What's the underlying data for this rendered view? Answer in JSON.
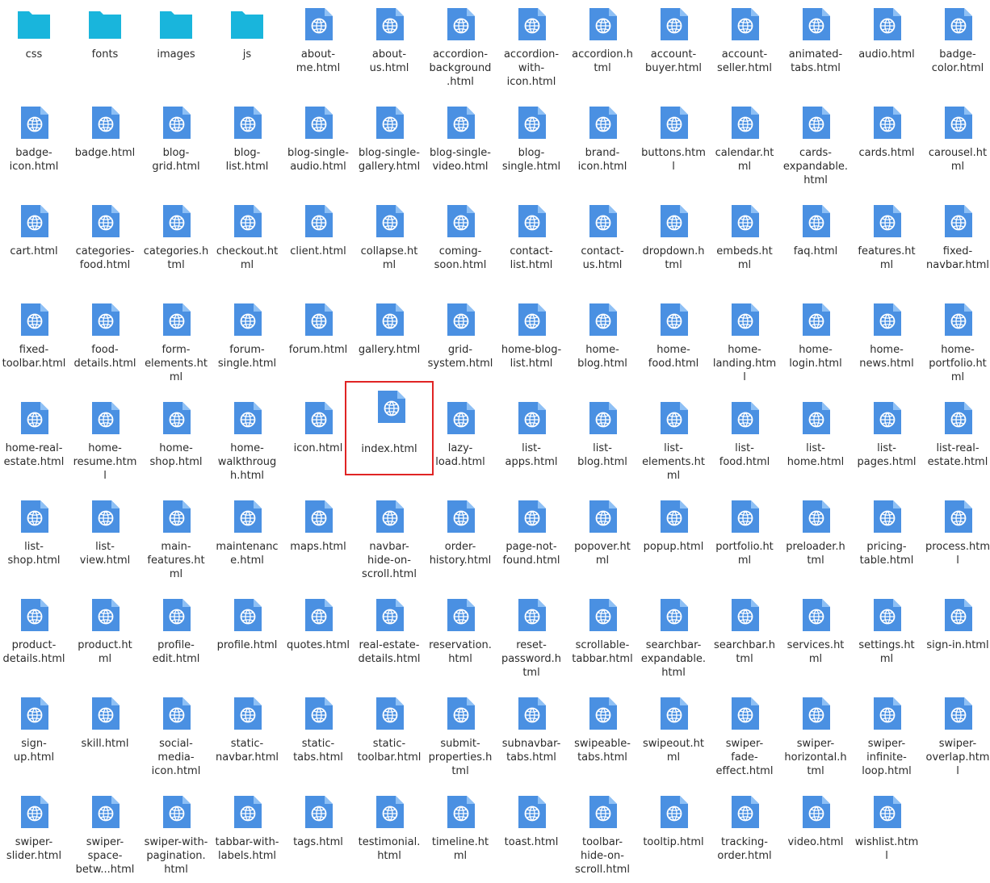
{
  "file_manager": {
    "selected": "index.html",
    "colors": {
      "folder": "#19b5dc",
      "file": "#4a90e2",
      "file_fold": "#8ec0f5",
      "selection": "#e02424"
    },
    "items": [
      {
        "name": "css",
        "label": "css",
        "type": "folder"
      },
      {
        "name": "fonts",
        "label": "fonts",
        "type": "folder"
      },
      {
        "name": "images",
        "label": "images",
        "type": "folder"
      },
      {
        "name": "js",
        "label": "js",
        "type": "folder"
      },
      {
        "name": "about-me.html",
        "label": "about-\nme.html",
        "type": "file"
      },
      {
        "name": "about-us.html",
        "label": "about-\nus.html",
        "type": "file"
      },
      {
        "name": "accordion-background.html",
        "label": "accordion-\nbackground\n.html",
        "type": "file"
      },
      {
        "name": "accordion-with-icon.html",
        "label": "accordion-\nwith-\nicon.html",
        "type": "file"
      },
      {
        "name": "accordion.html",
        "label": "accordion.h\ntml",
        "type": "file"
      },
      {
        "name": "account-buyer.html",
        "label": "account-\nbuyer.html",
        "type": "file"
      },
      {
        "name": "account-seller.html",
        "label": "account-\nseller.html",
        "type": "file"
      },
      {
        "name": "animated-tabs.html",
        "label": "animated-\ntabs.html",
        "type": "file"
      },
      {
        "name": "audio.html",
        "label": "audio.html",
        "type": "file"
      },
      {
        "name": "badge-color.html",
        "label": "badge-\ncolor.html",
        "type": "file"
      },
      {
        "name": "badge-icon.html",
        "label": "badge-\nicon.html",
        "type": "file"
      },
      {
        "name": "badge.html",
        "label": "badge.html",
        "type": "file"
      },
      {
        "name": "blog-grid.html",
        "label": "blog-\ngrid.html",
        "type": "file"
      },
      {
        "name": "blog-list.html",
        "label": "blog-\nlist.html",
        "type": "file"
      },
      {
        "name": "blog-single-audio.html",
        "label": "blog-single-\naudio.html",
        "type": "file"
      },
      {
        "name": "blog-single-gallery.html",
        "label": "blog-single-\ngallery.html",
        "type": "file"
      },
      {
        "name": "blog-single-video.html",
        "label": "blog-single-\nvideo.html",
        "type": "file"
      },
      {
        "name": "blog-single.html",
        "label": "blog-\nsingle.html",
        "type": "file"
      },
      {
        "name": "brand-icon.html",
        "label": "brand-\nicon.html",
        "type": "file"
      },
      {
        "name": "buttons.html",
        "label": "buttons.htm\nl",
        "type": "file"
      },
      {
        "name": "calendar.html",
        "label": "calendar.ht\nml",
        "type": "file"
      },
      {
        "name": "cards-expandable.html",
        "label": "cards-\nexpandable.\nhtml",
        "type": "file"
      },
      {
        "name": "cards.html",
        "label": "cards.html",
        "type": "file"
      },
      {
        "name": "carousel.html",
        "label": "carousel.ht\nml",
        "type": "file"
      },
      {
        "name": "cart.html",
        "label": "cart.html",
        "type": "file"
      },
      {
        "name": "categories-food.html",
        "label": "categories-\nfood.html",
        "type": "file"
      },
      {
        "name": "categories.html",
        "label": "categories.h\ntml",
        "type": "file"
      },
      {
        "name": "checkout.html",
        "label": "checkout.ht\nml",
        "type": "file"
      },
      {
        "name": "client.html",
        "label": "client.html",
        "type": "file"
      },
      {
        "name": "collapse.html",
        "label": "collapse.ht\nml",
        "type": "file"
      },
      {
        "name": "coming-soon.html",
        "label": "coming-\nsoon.html",
        "type": "file"
      },
      {
        "name": "contact-list.html",
        "label": "contact-\nlist.html",
        "type": "file"
      },
      {
        "name": "contact-us.html",
        "label": "contact-\nus.html",
        "type": "file"
      },
      {
        "name": "dropdown.html",
        "label": "dropdown.h\ntml",
        "type": "file"
      },
      {
        "name": "embeds.html",
        "label": "embeds.ht\nml",
        "type": "file"
      },
      {
        "name": "faq.html",
        "label": "faq.html",
        "type": "file"
      },
      {
        "name": "features.html",
        "label": "features.ht\nml",
        "type": "file"
      },
      {
        "name": "fixed-navbar.html",
        "label": "fixed-\nnavbar.html",
        "type": "file"
      },
      {
        "name": "fixed-toolbar.html",
        "label": "fixed-\ntoolbar.html",
        "type": "file"
      },
      {
        "name": "food-details.html",
        "label": "food-\ndetails.html",
        "type": "file"
      },
      {
        "name": "form-elements.html",
        "label": "form-\nelements.ht\nml",
        "type": "file"
      },
      {
        "name": "forum-single.html",
        "label": "forum-\nsingle.html",
        "type": "file"
      },
      {
        "name": "forum.html",
        "label": "forum.html",
        "type": "file"
      },
      {
        "name": "gallery.html",
        "label": "gallery.html",
        "type": "file"
      },
      {
        "name": "grid-system.html",
        "label": "grid-\nsystem.html",
        "type": "file"
      },
      {
        "name": "home-blog-list.html",
        "label": "home-blog-\nlist.html",
        "type": "file"
      },
      {
        "name": "home-blog.html",
        "label": "home-\nblog.html",
        "type": "file"
      },
      {
        "name": "home-food.html",
        "label": "home-\nfood.html",
        "type": "file"
      },
      {
        "name": "home-landing.html",
        "label": "home-\nlanding.htm\nl",
        "type": "file"
      },
      {
        "name": "home-login.html",
        "label": "home-\nlogin.html",
        "type": "file"
      },
      {
        "name": "home-news.html",
        "label": "home-\nnews.html",
        "type": "file"
      },
      {
        "name": "home-portfolio.html",
        "label": "home-\nportfolio.ht\nml",
        "type": "file"
      },
      {
        "name": "home-real-estate.html",
        "label": "home-real-\nestate.html",
        "type": "file"
      },
      {
        "name": "home-resume.html",
        "label": "home-\nresume.htm\nl",
        "type": "file"
      },
      {
        "name": "home-shop.html",
        "label": "home-\nshop.html",
        "type": "file"
      },
      {
        "name": "home-walkthrough.html",
        "label": "home-\nwalkthroug\nh.html",
        "type": "file"
      },
      {
        "name": "icon.html",
        "label": "icon.html",
        "type": "file"
      },
      {
        "name": "index.html",
        "label": "index.html",
        "type": "file"
      },
      {
        "name": "lazy-load.html",
        "label": "lazy-\nload.html",
        "type": "file"
      },
      {
        "name": "list-apps.html",
        "label": "list-\napps.html",
        "type": "file"
      },
      {
        "name": "list-blog.html",
        "label": "list-\nblog.html",
        "type": "file"
      },
      {
        "name": "list-elements.html",
        "label": "list-\nelements.ht\nml",
        "type": "file"
      },
      {
        "name": "list-food.html",
        "label": "list-\nfood.html",
        "type": "file"
      },
      {
        "name": "list-home.html",
        "label": "list-\nhome.html",
        "type": "file"
      },
      {
        "name": "list-pages.html",
        "label": "list-\npages.html",
        "type": "file"
      },
      {
        "name": "list-real-estate.html",
        "label": "list-real-\nestate.html",
        "type": "file"
      },
      {
        "name": "list-shop.html",
        "label": "list-\nshop.html",
        "type": "file"
      },
      {
        "name": "list-view.html",
        "label": "list-\nview.html",
        "type": "file"
      },
      {
        "name": "main-features.html",
        "label": "main-\nfeatures.ht\nml",
        "type": "file"
      },
      {
        "name": "maintenance.html",
        "label": "maintenanc\ne.html",
        "type": "file"
      },
      {
        "name": "maps.html",
        "label": "maps.html",
        "type": "file"
      },
      {
        "name": "navbar-hide-on-scroll.html",
        "label": "navbar-\nhide-on-\nscroll.html",
        "type": "file"
      },
      {
        "name": "order-history.html",
        "label": "order-\nhistory.html",
        "type": "file"
      },
      {
        "name": "page-not-found.html",
        "label": "page-not-\nfound.html",
        "type": "file"
      },
      {
        "name": "popover.html",
        "label": "popover.ht\nml",
        "type": "file"
      },
      {
        "name": "popup.html",
        "label": "popup.html",
        "type": "file"
      },
      {
        "name": "portfolio.html",
        "label": "portfolio.ht\nml",
        "type": "file"
      },
      {
        "name": "preloader.html",
        "label": "preloader.h\ntml",
        "type": "file"
      },
      {
        "name": "pricing-table.html",
        "label": "pricing-\ntable.html",
        "type": "file"
      },
      {
        "name": "process.html",
        "label": "process.htm\nl",
        "type": "file"
      },
      {
        "name": "product-details.html",
        "label": "product-\ndetails.html",
        "type": "file"
      },
      {
        "name": "product.html",
        "label": "product.ht\nml",
        "type": "file"
      },
      {
        "name": "profile-edit.html",
        "label": "profile-\nedit.html",
        "type": "file"
      },
      {
        "name": "profile.html",
        "label": "profile.html",
        "type": "file"
      },
      {
        "name": "quotes.html",
        "label": "quotes.html",
        "type": "file"
      },
      {
        "name": "real-estate-details.html",
        "label": "real-estate-\ndetails.html",
        "type": "file"
      },
      {
        "name": "reservation.html",
        "label": "reservation.\nhtml",
        "type": "file"
      },
      {
        "name": "reset-password.html",
        "label": "reset-\npassword.h\ntml",
        "type": "file"
      },
      {
        "name": "scrollable-tabbar.html",
        "label": "scrollable-\ntabbar.html",
        "type": "file"
      },
      {
        "name": "searchbar-expandable.html",
        "label": "searchbar-\nexpandable.\nhtml",
        "type": "file"
      },
      {
        "name": "searchbar.html",
        "label": "searchbar.h\ntml",
        "type": "file"
      },
      {
        "name": "services.html",
        "label": "services.ht\nml",
        "type": "file"
      },
      {
        "name": "settings.html",
        "label": "settings.ht\nml",
        "type": "file"
      },
      {
        "name": "sign-in.html",
        "label": "sign-in.html",
        "type": "file"
      },
      {
        "name": "sign-up.html",
        "label": "sign-\nup.html",
        "type": "file"
      },
      {
        "name": "skill.html",
        "label": "skill.html",
        "type": "file"
      },
      {
        "name": "social-media-icon.html",
        "label": "social-\nmedia-\nicon.html",
        "type": "file"
      },
      {
        "name": "static-navbar.html",
        "label": "static-\nnavbar.html",
        "type": "file"
      },
      {
        "name": "static-tabs.html",
        "label": "static-\ntabs.html",
        "type": "file"
      },
      {
        "name": "static-toolbar.html",
        "label": "static-\ntoolbar.html",
        "type": "file"
      },
      {
        "name": "submit-properties.html",
        "label": "submit-\nproperties.h\ntml",
        "type": "file"
      },
      {
        "name": "subnavbar-tabs.html",
        "label": "subnavbar-\ntabs.html",
        "type": "file"
      },
      {
        "name": "swipeable-tabs.html",
        "label": "swipeable-\ntabs.html",
        "type": "file"
      },
      {
        "name": "swipeout.html",
        "label": "swipeout.ht\nml",
        "type": "file"
      },
      {
        "name": "swiper-fade-effect.html",
        "label": "swiper-\nfade-\neffect.html",
        "type": "file"
      },
      {
        "name": "swiper-horizontal.html",
        "label": "swiper-\nhorizontal.h\ntml",
        "type": "file"
      },
      {
        "name": "swiper-infinite-loop.html",
        "label": "swiper-\ninfinite-\nloop.html",
        "type": "file"
      },
      {
        "name": "swiper-overlap.html",
        "label": "swiper-\noverlap.htm\nl",
        "type": "file"
      },
      {
        "name": "swiper-slider.html",
        "label": "swiper-\nslider.html",
        "type": "file"
      },
      {
        "name": "swiper-space-between.html",
        "label": "swiper-\nspace-\nbetw...html",
        "type": "file"
      },
      {
        "name": "swiper-with-pagination.html",
        "label": "swiper-with-\npagination.\nhtml",
        "type": "file"
      },
      {
        "name": "tabbar-with-labels.html",
        "label": "tabbar-with-\nlabels.html",
        "type": "file"
      },
      {
        "name": "tags.html",
        "label": "tags.html",
        "type": "file"
      },
      {
        "name": "testimonial.html",
        "label": "testimonial.\nhtml",
        "type": "file"
      },
      {
        "name": "timeline.html",
        "label": "timeline.ht\nml",
        "type": "file"
      },
      {
        "name": "toast.html",
        "label": "toast.html",
        "type": "file"
      },
      {
        "name": "toolbar-hide-on-scroll.html",
        "label": "toolbar-\nhide-on-\nscroll.html",
        "type": "file"
      },
      {
        "name": "tooltip.html",
        "label": "tooltip.html",
        "type": "file"
      },
      {
        "name": "tracking-order.html",
        "label": "tracking-\norder.html",
        "type": "file"
      },
      {
        "name": "video.html",
        "label": "video.html",
        "type": "file"
      },
      {
        "name": "wishlist.html",
        "label": "wishlist.htm\nl",
        "type": "file"
      }
    ]
  }
}
